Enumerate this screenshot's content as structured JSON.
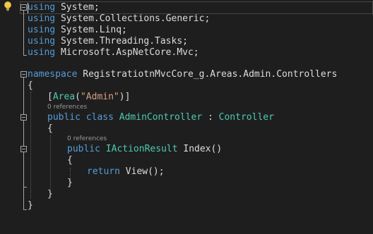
{
  "editor": {
    "language": "C#",
    "theme": {
      "background": "#1e1e1e",
      "keyword": "#569cd6",
      "type": "#4ec9b0",
      "string": "#d69d85",
      "text": "#dcdcdc",
      "codelens": "#999999"
    },
    "lines": {
      "l1": {
        "kw": "using",
        "rest": " System;"
      },
      "l2": {
        "kw": "using",
        "rest": " System.Collections.Generic;"
      },
      "l3": {
        "kw": "using",
        "rest": " System.Linq;"
      },
      "l4": {
        "kw": "using",
        "rest": " System.Threading.Tasks;"
      },
      "l5": {
        "kw": "using",
        "rest": " Microsoft.AspNetCore.Mvc;"
      },
      "l7": {
        "kw": "namespace",
        "rest": " RegistratiotnMvcCore_g.Areas.Admin.Controllers"
      },
      "l8": {
        "text": "{"
      },
      "l9": {
        "open": "[",
        "attr": "Area",
        "paren_open": "(",
        "str": "\"Admin\"",
        "close": ")]"
      },
      "l10": {
        "kw1": "public",
        "kw2": "class",
        "type": "AdminController",
        "colon": " : ",
        "base": "Controller"
      },
      "l11": {
        "text": "{"
      },
      "l12": {
        "kw": "public",
        "type": "IActionResult",
        "rest": " Index()"
      },
      "l13": {
        "text": "{"
      },
      "l14": {
        "kw": "return",
        "rest": " View();"
      },
      "l15": {
        "text": "}"
      },
      "l16": {
        "text": "}"
      },
      "l17": {
        "text": "}"
      }
    },
    "codelens": {
      "class_refs": "0 references",
      "method_refs": "0 references"
    },
    "icons": {
      "lightbulb": "lightbulb-icon",
      "fold": "collapse-icon"
    }
  }
}
